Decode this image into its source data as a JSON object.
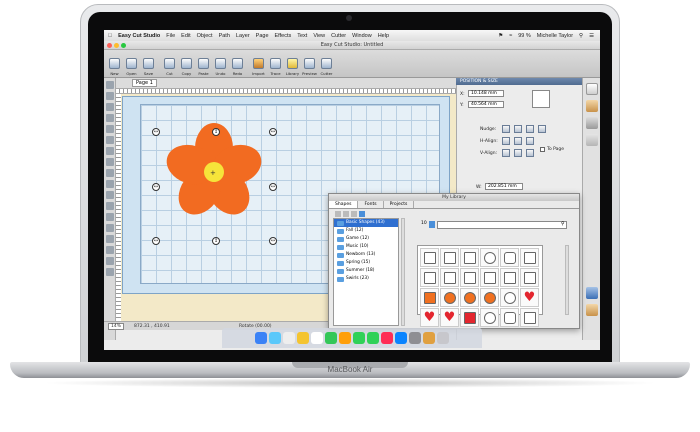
{
  "laptop": {
    "brand": "MacBook Air"
  },
  "menubar": {
    "app": "Easy Cut Studio",
    "items": [
      "File",
      "Edit",
      "Object",
      "Path",
      "Layer",
      "Page",
      "Effects",
      "Text",
      "View",
      "Cutter",
      "Window",
      "Help"
    ],
    "battery": "99 %",
    "user": "Michelle Taylor"
  },
  "window": {
    "title": "Easy Cut Studio: Untitled"
  },
  "toolbar": {
    "buttons": [
      "New",
      "Open",
      "Save",
      "Cut",
      "Copy",
      "Paste",
      "Undo",
      "Redo",
      "Import",
      "Trace",
      "Library",
      "Preview",
      "Cutter"
    ]
  },
  "canvas": {
    "tab": "Page 1",
    "coords": "872.31 , 410.91",
    "rotate": "Rotate (00.00)",
    "zoom": "14%"
  },
  "flower": {
    "petal_color": "#f26b21",
    "center_color": "#f6e43a"
  },
  "position_panel": {
    "header": "POSITION & SIZE",
    "x": "10.148 mm",
    "y": "40.564 mm",
    "nudge": "Nudge:",
    "halign": "H-Align:",
    "valign": "V-Align:",
    "to_page": "To Page",
    "w": "202.851 mm"
  },
  "library": {
    "title": "My Library",
    "tabs": [
      "Shapes",
      "Fonts",
      "Projects"
    ],
    "folders": [
      "Basic Shapes (43)",
      "Fall (12)",
      "Game (12)",
      "Music (10)",
      "Newborn (13)",
      "Spring (15)",
      "Summer (18)",
      "Swirls (23)"
    ],
    "size": "10"
  }
}
